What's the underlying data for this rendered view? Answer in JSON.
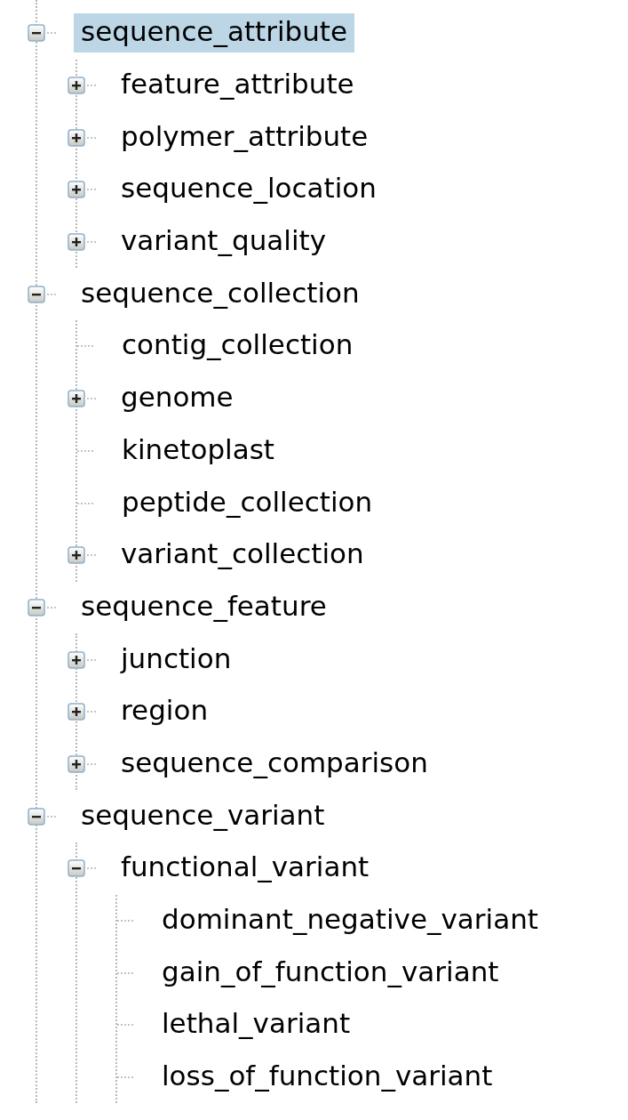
{
  "tree": [
    {
      "label": "sequence_attribute",
      "selected": true,
      "expanded": true,
      "children": [
        {
          "label": "feature_attribute",
          "selected": false,
          "expanded": false
        },
        {
          "label": "polymer_attribute",
          "selected": false,
          "expanded": false
        },
        {
          "label": "sequence_location",
          "selected": false,
          "expanded": false
        },
        {
          "label": "variant_quality",
          "selected": false,
          "expanded": false
        }
      ]
    },
    {
      "label": "sequence_collection",
      "selected": false,
      "expanded": true,
      "children": [
        {
          "label": "contig_collection",
          "selected": false
        },
        {
          "label": "genome",
          "selected": false,
          "expanded": false
        },
        {
          "label": "kinetoplast",
          "selected": false
        },
        {
          "label": "peptide_collection",
          "selected": false
        },
        {
          "label": "variant_collection",
          "selected": false,
          "expanded": false
        }
      ]
    },
    {
      "label": "sequence_feature",
      "selected": false,
      "expanded": true,
      "children": [
        {
          "label": "junction",
          "selected": false,
          "expanded": false
        },
        {
          "label": "region",
          "selected": false,
          "expanded": false
        },
        {
          "label": "sequence_comparison",
          "selected": false,
          "expanded": false
        }
      ]
    },
    {
      "label": "sequence_variant",
      "selected": false,
      "expanded": true,
      "children": [
        {
          "label": "functional_variant",
          "selected": false,
          "expanded": true,
          "children": [
            {
              "label": "dominant_negative_variant",
              "selected": false
            },
            {
              "label": "gain_of_function_variant",
              "selected": false
            },
            {
              "label": "lethal_variant",
              "selected": false
            },
            {
              "label": "loss_of_function_variant",
              "selected": false
            }
          ]
        }
      ]
    }
  ]
}
